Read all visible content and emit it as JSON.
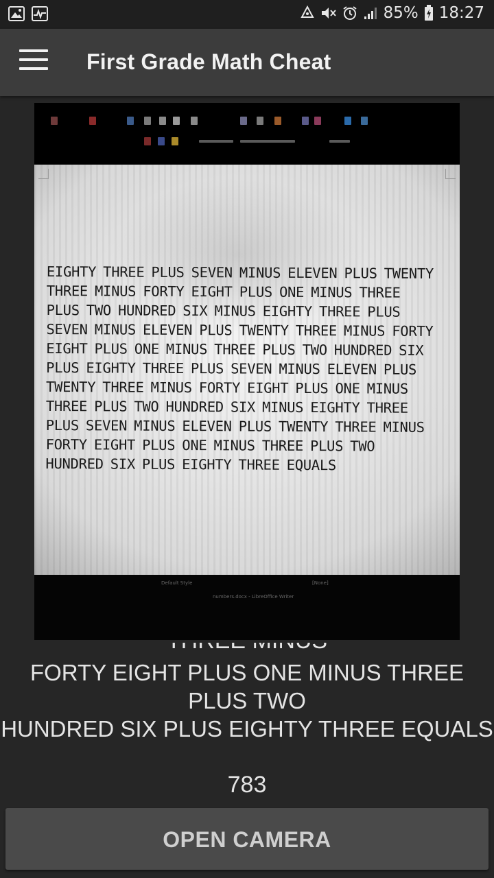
{
  "status_bar": {
    "battery": "85%",
    "time": "18:27",
    "icons": [
      "gallery-icon",
      "activity-icon",
      "recycle-icon",
      "mute-icon",
      "alarm-icon",
      "signal-icon",
      "battery-icon"
    ]
  },
  "app_bar": {
    "title": "First Grade Math Cheat",
    "menu_icon": "hamburger-menu-icon"
  },
  "photo": {
    "document_lines": [
      "EIGHTY THREE PLUS SEVEN MINUS ELEVEN PLUS TWENTY",
      "THREE MINUS FORTY EIGHT PLUS ONE MINUS THREE",
      "PLUS TWO HUNDRED SIX MINUS EIGHTY THREE PLUS",
      "SEVEN MINUS ELEVEN PLUS TWENTY THREE MINUS FORTY",
      "EIGHT PLUS ONE MINUS THREE PLUS TWO HUNDRED SIX",
      "PLUS EIGHTY THREE PLUS SEVEN MINUS ELEVEN PLUS",
      "TWENTY THREE MINUS FORTY EIGHT PLUS ONE MINUS",
      "THREE PLUS TWO HUNDRED SIX MINUS EIGHTY THREE",
      "PLUS SEVEN MINUS ELEVEN PLUS TWENTY THREE MINUS",
      "FORTY EIGHT PLUS ONE MINUS THREE PLUS TWO",
      "HUNDRED SIX PLUS EIGHTY THREE EQUALS"
    ],
    "status_style": "Default Style",
    "status_lang": "[None]",
    "taskbar_item": "numbers.docx - LibreOffice Writer"
  },
  "recognized": {
    "partial_line": "THREE MINUS",
    "lines": [
      "FORTY EIGHT PLUS ONE MINUS THREE",
      "PLUS TWO",
      "HUNDRED SIX PLUS EIGHTY THREE EQUALS"
    ],
    "result": "783"
  },
  "actions": {
    "open_camera": "OPEN CAMERA"
  },
  "colors": {
    "background": "#262626",
    "app_bar": "#3c3c3c",
    "status_bar": "#1f1f1f",
    "button": "#4a4a4a",
    "text": "#e4e4e4"
  }
}
